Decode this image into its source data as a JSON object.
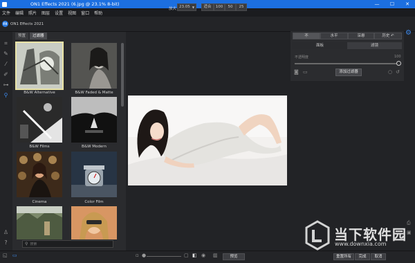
{
  "window": {
    "title": "ON1 Effects 2021 (6.jpg @ 23.1% 8-bit)",
    "minimize": "—",
    "maximize": "☐",
    "close": "✕"
  },
  "menu": [
    "文件",
    "编辑",
    "照片",
    "图层",
    "设置",
    "视图",
    "窗口",
    "帮助"
  ],
  "app": {
    "logo_text": "ON1 Effects 2021",
    "logo_badge": "FX"
  },
  "zoom": {
    "label": "放大",
    "value": "23.05",
    "buttons": [
      "适合",
      "100",
      "50",
      "25"
    ]
  },
  "browser": {
    "tabs": [
      "预置",
      "过滤器"
    ],
    "active_tab": 1,
    "thumbnails": [
      {
        "label": "B&W Alternative",
        "selected": true
      },
      {
        "label": "B&W Faded & Matte",
        "selected": false
      },
      {
        "label": "B&W Films",
        "selected": false
      },
      {
        "label": "B&W Modern",
        "selected": false
      },
      {
        "label": "Cinema",
        "selected": false
      },
      {
        "label": "Color Film",
        "selected": false
      },
      {
        "label": "",
        "selected": false
      },
      {
        "label": "",
        "selected": false
      }
    ],
    "search_placeholder": "搜索"
  },
  "right_panel": {
    "blend_modes": [
      "不",
      "水平",
      "深悬",
      "历史 ↶"
    ],
    "active_blend": 0,
    "tabs": [
      "面板",
      "滤镜"
    ],
    "active_tab": 1,
    "opacity_label": "不透明度",
    "opacity_value": "100",
    "add_filter": "添加过滤器"
  },
  "bottom": {
    "preview": "预览",
    "reset_all": "重置所有",
    "done": "完成",
    "cancel": "取消"
  },
  "watermark": {
    "text": "当下软件园",
    "url": "www.downxia.com"
  },
  "colors": {
    "accent": "#1c6fe0",
    "panel": "#2a2b2e",
    "bg": "#222326"
  }
}
